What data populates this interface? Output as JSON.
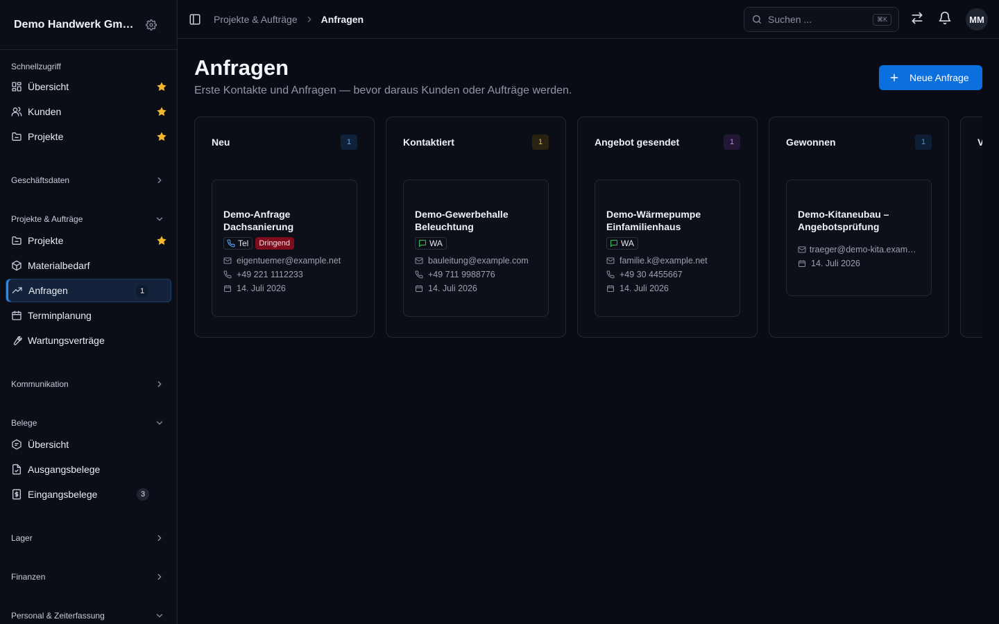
{
  "app": {
    "org_name": "Demo Handwerk GmbH"
  },
  "sidebar": {
    "quick": {
      "title": "Schnellzugriff",
      "items": [
        {
          "label": "Übersicht",
          "icon": "dashboard-icon",
          "starred": true
        },
        {
          "label": "Kunden",
          "icon": "users-icon",
          "starred": true
        },
        {
          "label": "Projekte",
          "icon": "folder-icon",
          "starred": true
        }
      ]
    },
    "geschaeftsdaten": {
      "title": "Geschäftsdaten"
    },
    "projekte": {
      "title": "Projekte & Aufträge",
      "items": [
        {
          "label": "Projekte",
          "icon": "folder-icon",
          "starred": true
        },
        {
          "label": "Materialbedarf",
          "icon": "package-icon"
        },
        {
          "label": "Anfragen",
          "icon": "trending-up-icon",
          "count": "1",
          "active": true
        },
        {
          "label": "Terminplanung",
          "icon": "calendar-icon"
        },
        {
          "label": "Wartungsverträge",
          "icon": "wrench-icon"
        }
      ]
    },
    "kommunikation": {
      "title": "Kommunikation"
    },
    "belege": {
      "title": "Belege",
      "items": [
        {
          "label": "Übersicht",
          "icon": "receipt-icon"
        },
        {
          "label": "Ausgangsbelege",
          "icon": "file-check-icon"
        },
        {
          "label": "Eingangsbelege",
          "icon": "dollar-file-icon",
          "count": "3"
        }
      ]
    },
    "lager": {
      "title": "Lager"
    },
    "finanzen": {
      "title": "Finanzen"
    },
    "personal": {
      "title": "Personal & Zeiterfassung"
    }
  },
  "topbar": {
    "breadcrumb_parent": "Projekte & Aufträge",
    "breadcrumb_current": "Anfragen",
    "search_placeholder": "Suchen ...",
    "search_shortcut": "⌘K",
    "avatar_initials": "MM"
  },
  "page": {
    "title": "Anfragen",
    "subtitle": "Erste Kontakte und Anfragen — bevor daraus Kunden oder Aufträge werden.",
    "new_button": "Neue Anfrage"
  },
  "columns": [
    {
      "title": "Neu",
      "count": "1",
      "badge_bg": "#10213a",
      "badge_fg": "#5aa4f5",
      "card": {
        "title": "Demo-Anfrage Dachsanierung",
        "channel": "Tel",
        "channel_icon": "phone-icon",
        "urgent": "Dringend",
        "email": "eigentuemer@example.net",
        "phone": "+49 221 1112233",
        "date": "14. Juli 2026"
      }
    },
    {
      "title": "Kontaktiert",
      "count": "1",
      "badge_bg": "#2a2210",
      "badge_fg": "#eab53a",
      "card": {
        "title": "Demo-Gewerbehalle Beleuchtung",
        "channel": "WA",
        "channel_icon": "message-icon",
        "email": "bauleitung@example.com",
        "phone": "+49 711 9988776",
        "date": "14. Juli 2026"
      }
    },
    {
      "title": "Angebot gesendet",
      "count": "1",
      "badge_bg": "#221737",
      "badge_fg": "#b387f5",
      "card": {
        "title": "Demo-Wärmepumpe Einfamilienhaus",
        "channel": "WA",
        "channel_icon": "message-icon",
        "email": "familie.k@example.net",
        "phone": "+49 30 4455667",
        "date": "14. Juli 2026"
      }
    },
    {
      "title": "Gewonnen",
      "count": "1",
      "badge_bg": "#0f1f33",
      "badge_fg": "#3f8fe0",
      "card": {
        "title": "Demo-Kitaneubau – Angebotsprüfung",
        "email": "traeger@demo-kita.example.net",
        "date": "14. Juli 2026"
      }
    }
  ],
  "partial_column_initial": "V",
  "colors": {
    "accent": "#0b6fdd",
    "star": "#f5b82e",
    "urgent": "#7d0c1d"
  }
}
